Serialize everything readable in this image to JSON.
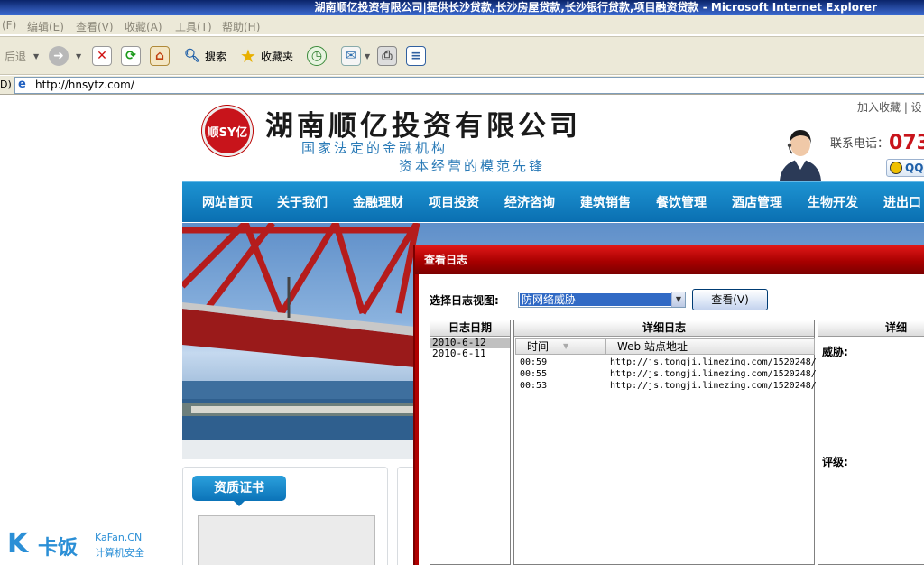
{
  "window": {
    "title": "湖南顺亿投资有限公司|提供长沙贷款,长沙房屋贷款,长沙银行贷款,项目融资贷款 - Microsoft Internet Explorer"
  },
  "menu": {
    "items": [
      "(F)",
      "编辑(E)",
      "查看(V)",
      "收藏(A)",
      "工具(T)",
      "帮助(H)"
    ]
  },
  "toolbar": {
    "back_label": "后退",
    "search_label": "搜索",
    "favorites_label": "收藏夹"
  },
  "address": {
    "prefix": "D)",
    "url": "http://hnsytz.com/"
  },
  "site": {
    "logo_text": "顺SY亿",
    "company": "湖南顺亿投资有限公司",
    "slogan1": "国家法定的金融机构",
    "slogan2": "资本经营的模范先锋",
    "top_links": "加入收藏 | 设",
    "phone_label": "联系电话：",
    "phone_number": "073",
    "qq_label": "QQ",
    "nav": [
      "网站首页",
      "关于我们",
      "金融理财",
      "项目投资",
      "经济咨询",
      "建筑销售",
      "餐饮管理",
      "酒店管理",
      "生物开发",
      "进出口"
    ],
    "cert_title": "资质证书"
  },
  "dialog": {
    "title": "查看日志",
    "view_label": "选择日志视图:",
    "view_value": "防网络威胁",
    "view_button": "查看(V)",
    "dates_header": "日志日期",
    "dates": [
      "2010-6-12",
      "2010-6-11"
    ],
    "detail_header": "详细日志",
    "col_time": "时间",
    "col_site": "Web 站点地址",
    "rows": [
      {
        "time": "00:59",
        "url": "http://js.tongji.linezing.com/1520248/"
      },
      {
        "time": "00:55",
        "url": "http://js.tongji.linezing.com/1520248/"
      },
      {
        "time": "00:53",
        "url": "http://js.tongji.linezing.com/1520248/"
      }
    ],
    "info_header": "详细",
    "threat_label": "威胁:",
    "level_label": "评级:"
  },
  "watermark": {
    "name": "卡饭",
    "en": "KaFan.CN",
    "cn": "计算机安全"
  }
}
